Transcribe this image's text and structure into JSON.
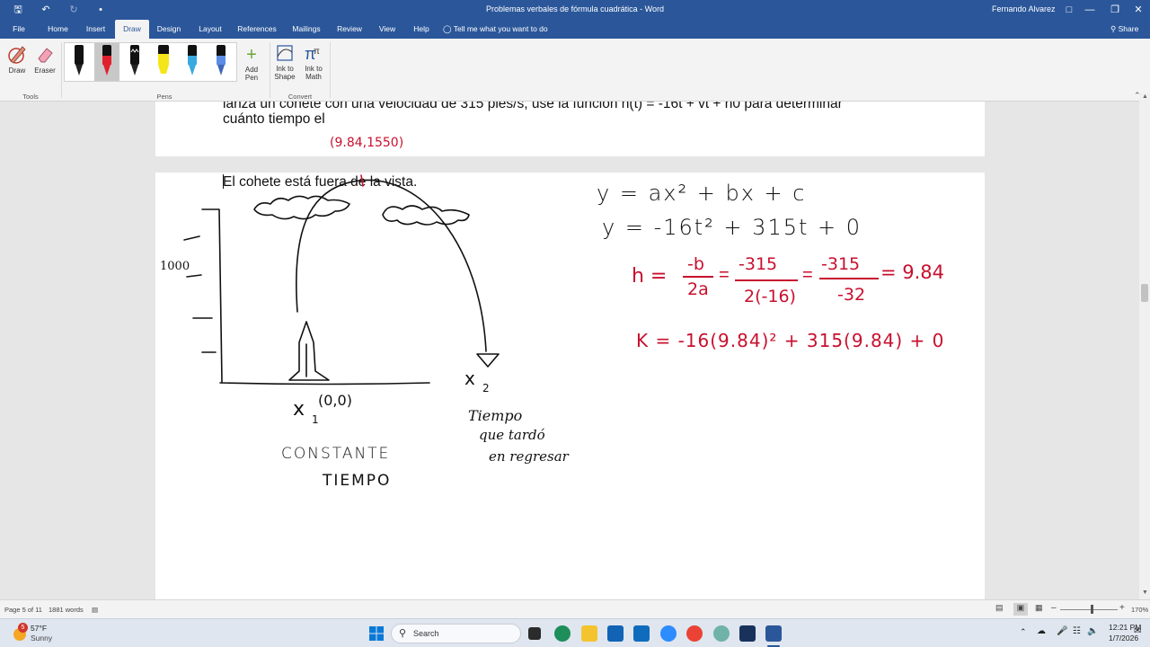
{
  "titlebar": {
    "document_title": "Problemas verbales de fórmula cuadrática  -  Word",
    "user": "Fernando Alvarez"
  },
  "tabs": [
    {
      "label": "File"
    },
    {
      "label": "Home"
    },
    {
      "label": "Insert"
    },
    {
      "label": "Draw"
    },
    {
      "label": "Design"
    },
    {
      "label": "Layout"
    },
    {
      "label": "References"
    },
    {
      "label": "Mailings"
    },
    {
      "label": "Review"
    },
    {
      "label": "View"
    },
    {
      "label": "Help"
    }
  ],
  "tellme": "Tell me what you want to do",
  "share": "Share",
  "ribbon": {
    "tools": {
      "draw": "Draw",
      "eraser": "Eraser",
      "group": "Tools"
    },
    "pens": {
      "add_pen": "Add Pen",
      "group": "Pens"
    },
    "convert": {
      "ink_to_shape": "Ink to Shape",
      "ink_to_math": "Ink to Math",
      "group": "Convert"
    }
  },
  "document": {
    "line1": "lanza un cohete con una velocidad de 315 pies/s, use la función h(t) = -16t + vt + h0 para determinar",
    "line2": "cuánto tiempo el",
    "page2_text": "El cohete está fuera de la vista.",
    "ink": {
      "vertex": "(9.84,1550)",
      "axis_label": "1000",
      "origin": "(0,0)",
      "x1": "x",
      "x1_sub": "1",
      "x2": "x",
      "x2_sub": "2",
      "tiempo1": "Tiempo",
      "tiempo2": "que tardó",
      "tiempo3": "en regresar",
      "constante1": "CONSTANTE",
      "constante2": "TIEMPO",
      "eq1": "y = ax² + bx + c",
      "eq2": "y = -16t² + 315t + 0",
      "eq3_h": "h =",
      "eq3_f1n": "-b",
      "eq3_f1d": "2a",
      "eq3_f2n": "-315",
      "eq3_f2d": "2(-16)",
      "eq3_f3n": "-315",
      "eq3_f3d": "-32",
      "eq3_result": "= 9.84",
      "eq4": "K = -16(9.84)² + 315(9.84) + 0"
    }
  },
  "statusbar": {
    "page": "Page 5 of 11",
    "words": "1881 words",
    "zoom": "170%"
  },
  "taskbar": {
    "weather_temp": "57°F",
    "weather_desc": "Sunny",
    "weather_badge": "5",
    "search": "Search",
    "time": "12:21 PM",
    "date": "1/7/2026"
  },
  "colors": {
    "word_blue": "#2b579a",
    "ink_red": "#c8102e"
  }
}
